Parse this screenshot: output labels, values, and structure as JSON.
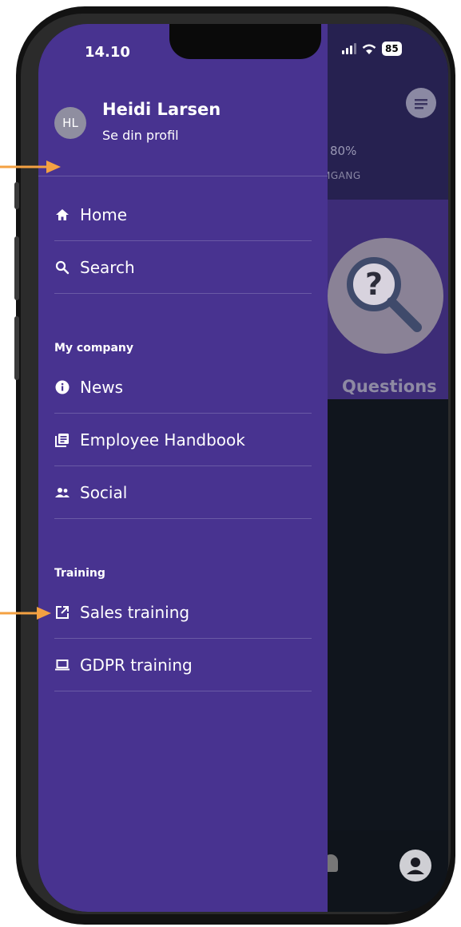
{
  "status_bar": {
    "time": "14.10",
    "battery": "85"
  },
  "background_app": {
    "progress_text": "80%",
    "progress_label": "MGANG",
    "tile_label": "Questions"
  },
  "profile": {
    "initials": "HL",
    "name": "Heidi Larsen",
    "link": "Se din profil"
  },
  "menu": {
    "main_items": [
      {
        "label": "Home",
        "icon": "home-icon"
      },
      {
        "label": "Search",
        "icon": "search-icon"
      }
    ],
    "sections": [
      {
        "title": "My company",
        "items": [
          {
            "label": "News",
            "icon": "info-icon"
          },
          {
            "label": "Employee Handbook",
            "icon": "book-icon"
          },
          {
            "label": "Social",
            "icon": "people-icon"
          }
        ]
      },
      {
        "title": "Training",
        "items": [
          {
            "label": "Sales training",
            "icon": "external-link-icon"
          },
          {
            "label": "GDPR training",
            "icon": "laptop-icon"
          }
        ]
      }
    ]
  },
  "colors": {
    "drawer": "#483390",
    "annotation_arrow": "#f4a142"
  }
}
